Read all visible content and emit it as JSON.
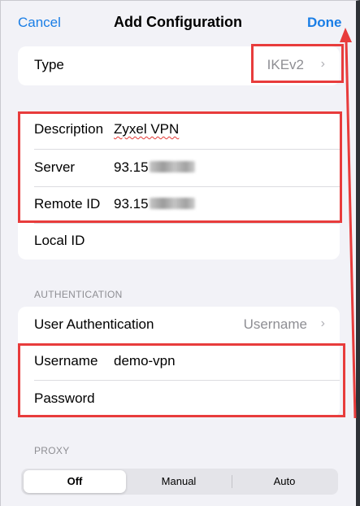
{
  "navbar": {
    "cancel_label": "Cancel",
    "title": "Add Configuration",
    "done_label": "Done"
  },
  "type_row": {
    "label": "Type",
    "value": "IKEv2",
    "chevron": "›"
  },
  "config": {
    "description_label": "Description",
    "description_value": "Zyxel VPN",
    "server_label": "Server",
    "server_value": "93.15",
    "remote_id_label": "Remote ID",
    "remote_id_value": "93.15",
    "local_id_label": "Local ID"
  },
  "authentication": {
    "header": "AUTHENTICATION",
    "user_auth_label": "User Authentication",
    "user_auth_value": "Username",
    "chevron": "›",
    "username_label": "Username",
    "username_value": "demo-vpn",
    "password_label": "Password"
  },
  "proxy": {
    "header": "PROXY",
    "options": [
      "Off",
      "Manual",
      "Auto"
    ],
    "selected": "Off"
  },
  "colors": {
    "accent": "#1a7ee6",
    "annotation": "#e83c3c",
    "background": "#f2f2f7"
  },
  "icons": {
    "chevron": "chevron-right-icon",
    "arrow": "annotation-arrow-icon"
  }
}
